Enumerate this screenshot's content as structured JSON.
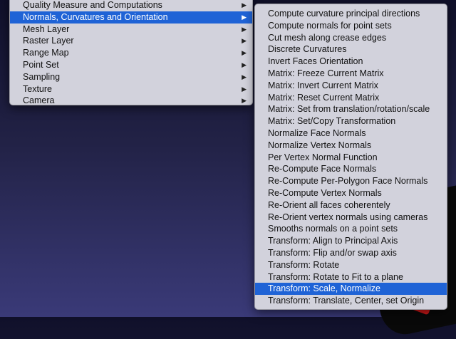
{
  "parent_menu": {
    "items": [
      {
        "label": "Quality Measure and Computations",
        "has_submenu": true,
        "selected": false
      },
      {
        "label": "Normals, Curvatures and Orientation",
        "has_submenu": true,
        "selected": true
      },
      {
        "label": "Mesh Layer",
        "has_submenu": true,
        "selected": false
      },
      {
        "label": "Raster Layer",
        "has_submenu": true,
        "selected": false
      },
      {
        "label": "Range Map",
        "has_submenu": true,
        "selected": false
      },
      {
        "label": "Point Set",
        "has_submenu": true,
        "selected": false
      },
      {
        "label": "Sampling",
        "has_submenu": true,
        "selected": false
      },
      {
        "label": "Texture",
        "has_submenu": true,
        "selected": false
      },
      {
        "label": "Camera",
        "has_submenu": true,
        "selected": false
      }
    ],
    "submenu_arrow_icon": "▶"
  },
  "submenu": {
    "items": [
      {
        "label": "Compute curvature principal directions",
        "selected": false
      },
      {
        "label": "Compute normals for point sets",
        "selected": false
      },
      {
        "label": "Cut mesh along crease edges",
        "selected": false
      },
      {
        "label": "Discrete Curvatures",
        "selected": false
      },
      {
        "label": "Invert Faces Orientation",
        "selected": false
      },
      {
        "label": "Matrix: Freeze Current Matrix",
        "selected": false
      },
      {
        "label": "Matrix: Invert Current Matrix",
        "selected": false
      },
      {
        "label": "Matrix: Reset Current Matrix",
        "selected": false
      },
      {
        "label": "Matrix: Set from translation/rotation/scale",
        "selected": false
      },
      {
        "label": "Matrix: Set/Copy Transformation",
        "selected": false
      },
      {
        "label": "Normalize Face Normals",
        "selected": false
      },
      {
        "label": "Normalize Vertex Normals",
        "selected": false
      },
      {
        "label": "Per Vertex Normal Function",
        "selected": false
      },
      {
        "label": "Re-Compute Face Normals",
        "selected": false
      },
      {
        "label": "Re-Compute Per-Polygon Face Normals",
        "selected": false
      },
      {
        "label": "Re-Compute Vertex Normals",
        "selected": false
      },
      {
        "label": "Re-Orient all faces coherentely",
        "selected": false
      },
      {
        "label": "Re-Orient vertex normals using cameras",
        "selected": false
      },
      {
        "label": "Smooths normals on a point sets",
        "selected": false
      },
      {
        "label": "Transform: Align to Principal Axis",
        "selected": false
      },
      {
        "label": "Transform: Flip and/or swap axis",
        "selected": false
      },
      {
        "label": "Transform: Rotate",
        "selected": false
      },
      {
        "label": "Transform: Rotate to Fit to a plane",
        "selected": false
      },
      {
        "label": "Transform: Scale, Normalize",
        "selected": true
      },
      {
        "label": "Transform: Translate, Center, set Origin",
        "selected": false
      }
    ]
  },
  "colors": {
    "menu_background": "#d2d2dc",
    "selection": "#1f63d6",
    "viewport_background": "#222246"
  }
}
